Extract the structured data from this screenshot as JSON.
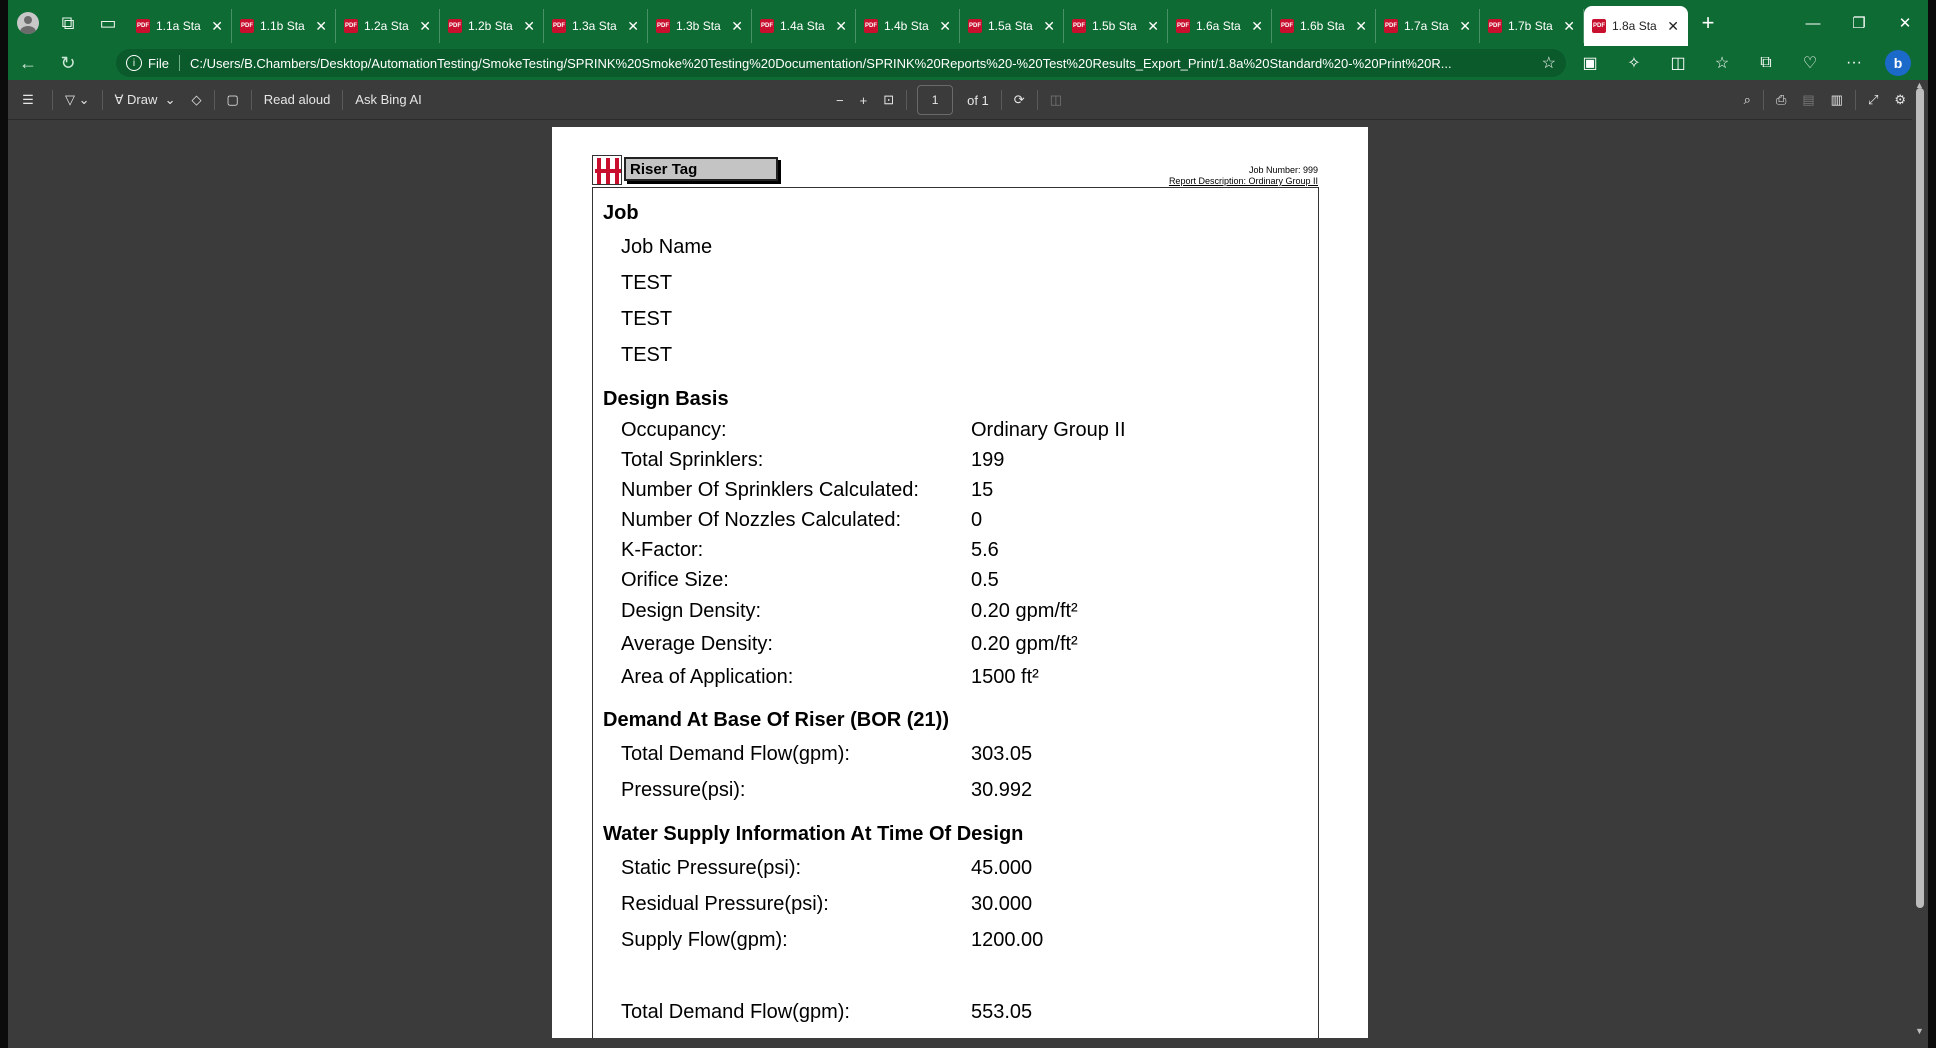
{
  "browser": {
    "tabs": [
      {
        "label": "1.1a Sta"
      },
      {
        "label": "1.1b Sta"
      },
      {
        "label": "1.2a Sta"
      },
      {
        "label": "1.2b Sta"
      },
      {
        "label": "1.3a Sta"
      },
      {
        "label": "1.3b Sta"
      },
      {
        "label": "1.4a Sta"
      },
      {
        "label": "1.4b Sta"
      },
      {
        "label": "1.5a Sta"
      },
      {
        "label": "1.5b Sta"
      },
      {
        "label": "1.6a Sta"
      },
      {
        "label": "1.6b Sta"
      },
      {
        "label": "1.7a Sta"
      },
      {
        "label": "1.7b Sta"
      },
      {
        "label": "1.8a Sta"
      }
    ],
    "address": {
      "scheme_label": "File",
      "url": "C:/Users/B.Chambers/Desktop/AutomationTesting/SmokeTesting/SPRINK%20Smoke%20Testing%20Documentation/SPRINK%20Reports%20-%20Test%20Results_Export_Print/1.8a%20Standard%20-%20Print%20R..."
    },
    "accent_color": "#0e6b34"
  },
  "pdf_toolbar": {
    "draw_label": "Draw",
    "read_aloud_label": "Read aloud",
    "ask_bing_label": "Ask Bing AI",
    "page_current": "1",
    "page_total": "of 1"
  },
  "report": {
    "tag_title": "Riser Tag",
    "job_number_line": "Job Number: 999",
    "report_description_line": "Report Description: Ordinary Group II",
    "job": {
      "heading": "Job",
      "lines": [
        "Job Name",
        "TEST",
        "TEST",
        "TEST"
      ]
    },
    "design_basis": {
      "heading": "Design Basis",
      "rows": [
        {
          "label": "Occupancy:",
          "value": "Ordinary Group II"
        },
        {
          "label": "Total Sprinklers:",
          "value": "199"
        },
        {
          "label": "Number Of Sprinklers Calculated:",
          "value": "15"
        },
        {
          "label": "Number Of Nozzles Calculated:",
          "value": "0"
        },
        {
          "label": "K-Factor:",
          "value": "5.6"
        },
        {
          "label": "Orifice Size:",
          "value": "0.5"
        },
        {
          "label": "Design Density:",
          "value": "0.20 gpm/ft²"
        },
        {
          "label": "Average Density:",
          "value": "0.20 gpm/ft²"
        },
        {
          "label": "Area of Application:",
          "value": "1500 ft²"
        }
      ]
    },
    "demand_bor": {
      "heading": "Demand At Base Of Riser (BOR (21))",
      "rows": [
        {
          "label": "Total Demand Flow(gpm):",
          "value": "303.05"
        },
        {
          "label": "Pressure(psi):",
          "value": "30.992"
        }
      ]
    },
    "water_supply": {
      "heading": "Water Supply Information At Time Of Design",
      "rows": [
        {
          "label": "Static Pressure(psi):",
          "value": "45.000"
        },
        {
          "label": "Residual Pressure(psi):",
          "value": "30.000"
        },
        {
          "label": "Supply Flow(gpm):",
          "value": "1200.00"
        }
      ]
    },
    "totals": {
      "rows": [
        {
          "label": "Total Demand Flow(gpm):",
          "value": "553.05"
        }
      ]
    }
  }
}
